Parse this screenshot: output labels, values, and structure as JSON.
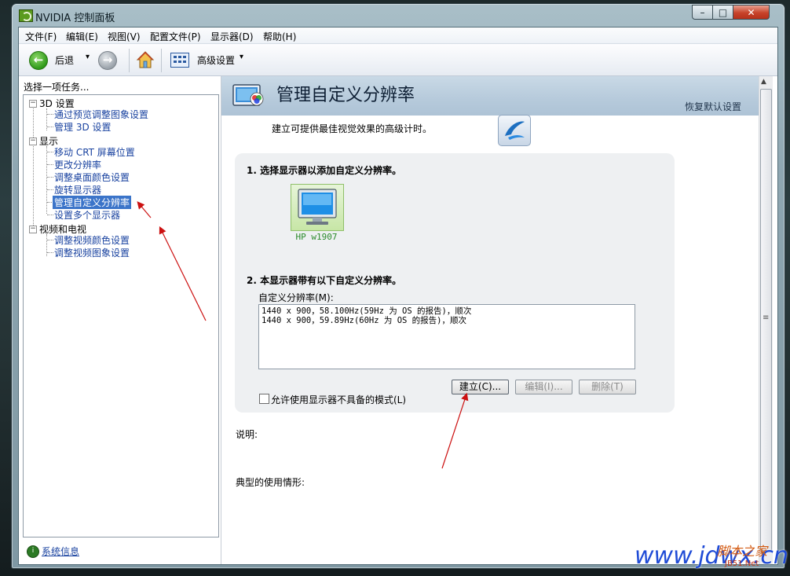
{
  "window": {
    "title": "NVIDIA 控制面板"
  },
  "caption_buttons": {
    "minimize": "–",
    "maximize": "□",
    "close": "✕"
  },
  "menu": {
    "items": [
      "文件(F)",
      "编辑(E)",
      "视图(V)",
      "配置文件(P)",
      "显示器(D)",
      "帮助(H)"
    ]
  },
  "toolbar": {
    "back_label": "后退",
    "dropdown_glyph": "▾",
    "advanced_label": "高级设置",
    "back_icon": "arrow-left-icon",
    "forward_icon": "arrow-right-icon",
    "home_icon": "home-icon",
    "grid_icon": "grid-view-icon"
  },
  "left": {
    "header": "选择一项任务...",
    "tree": [
      {
        "label": "3D 设置",
        "expander": "−",
        "children": [
          "通过预览调整图象设置",
          "管理 3D 设置"
        ]
      },
      {
        "label": "显示",
        "expander": "−",
        "children": [
          "移动 CRT 屏幕位置",
          "更改分辨率",
          "调整桌面颜色设置",
          "旋转显示器",
          "管理自定义分辨率",
          "设置多个显示器"
        ]
      },
      {
        "label": "视频和电视",
        "expander": "−",
        "children": [
          "调整视频颜色设置",
          "调整视频图象设置"
        ]
      }
    ],
    "selected": "管理自定义分辨率",
    "system_info": "系统信息"
  },
  "page": {
    "title": "管理自定义分辨率",
    "restore_defaults": "恢复默认设置",
    "intro": "建立可提供最佳视觉效果的高级计时。",
    "step1": "1. 选择显示器以添加自定义分辨率。",
    "monitor_name": "HP w1907",
    "step2": "2. 本显示器带有以下自定义分辨率。",
    "resolutions_label": "自定义分辨率(M):",
    "resolutions": [
      "1440 x 900，58.100Hz(59Hz 为 OS 的报告)，顺次",
      "1440 x 900，59.89Hz(60Hz 为 OS 的报告)，顺次"
    ],
    "buttons": {
      "create": "建立(C)...",
      "edit": "编辑(I)...",
      "delete": "删除(T)"
    },
    "allow_modes_label": "允许使用显示器不具备的模式(L)",
    "description_label": "说明:",
    "usage_label": "典型的使用情形:"
  },
  "scroll": {
    "up": "▲",
    "down": "▼",
    "grip": "≡"
  },
  "watermark": {
    "cn": "脚本之家",
    "en": "www.jdwx.cn",
    "small": "JB51.Net"
  },
  "colors": {
    "accent": "#3b74c9",
    "banner": "#b6cadb",
    "link": "#1a43a0",
    "arrow": "#cc1111"
  }
}
